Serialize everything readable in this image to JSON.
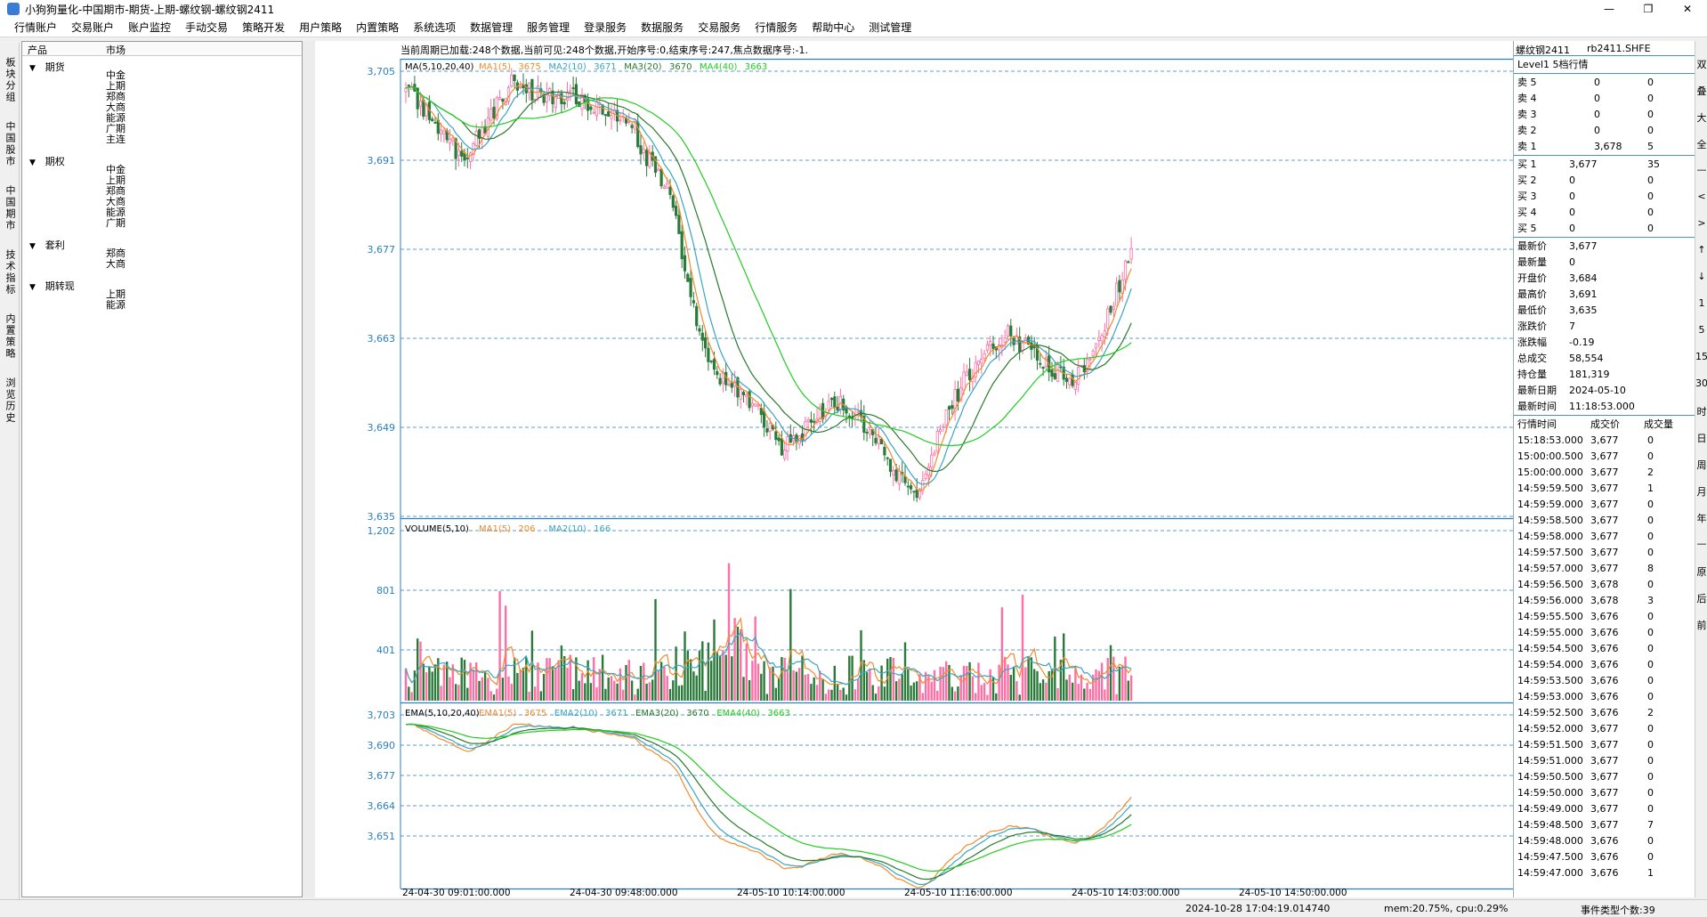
{
  "window": {
    "title": "小狗狗量化-中国期市-期货-上期-螺纹钢-螺纹钢2411",
    "controls": [
      "—",
      "❐",
      "✕"
    ]
  },
  "menu": [
    "行情账户",
    "交易账户",
    "账户监控",
    "手动交易",
    "策略开发",
    "用户策略",
    "内置策略",
    "系统选项",
    "数据管理",
    "服务管理",
    "登录服务",
    "数据服务",
    "交易服务",
    "行情服务",
    "帮助中心",
    "测试管理"
  ],
  "left_tabs": [
    "板块分组",
    "中国股市",
    "中国期市",
    "技术指标",
    "内置策略",
    "浏览历史"
  ],
  "tree": {
    "col_product": "产品",
    "col_market": "市场",
    "categories": [
      {
        "name": "期货",
        "markets": [
          "中金",
          "上期",
          "郑商",
          "大商",
          "能源",
          "广期",
          "主连"
        ]
      },
      {
        "name": "期权",
        "markets": [
          "中金",
          "上期",
          "郑商",
          "大商",
          "能源",
          "广期"
        ]
      },
      {
        "name": "套利",
        "markets": [
          "郑商",
          "大商"
        ]
      },
      {
        "name": "期转现",
        "markets": [
          "上期",
          "能源"
        ]
      }
    ]
  },
  "chart": {
    "info_line": "当前周期已加载:248个数据,当前可见:248个数据,开始序号:0,结束序号:247,焦点数据序号:-1.",
    "main": {
      "label": "MA(5,10,20,40)",
      "ma_legend": [
        {
          "name": "MA1(5)",
          "value": "3675",
          "color": "#f08c2e"
        },
        {
          "name": "MA2(10)",
          "value": "3671",
          "color": "#3aa5c2"
        },
        {
          "name": "MA3(20)",
          "value": "3670",
          "color": "#2a7a2a"
        },
        {
          "name": "MA4(40)",
          "value": "3663",
          "color": "#22cc22"
        }
      ],
      "y_labels": [
        "3,705",
        "3,691",
        "3,677",
        "3,663",
        "3,649",
        "3,635"
      ]
    },
    "volume": {
      "label": "VOLUME(5,10)",
      "ma_legend": [
        {
          "name": "MA1(5)",
          "value": "206",
          "color": "#f08c2e"
        },
        {
          "name": "MA2(10)",
          "value": "166",
          "color": "#3aa5c2"
        }
      ],
      "y_labels": [
        "1,202",
        "801",
        "401"
      ]
    },
    "ema": {
      "label": "EMA(5,10,20,40)",
      "ma_legend": [
        {
          "name": "EMA1(5)",
          "value": "3675",
          "color": "#f08c2e"
        },
        {
          "name": "EMA2(10)",
          "value": "3671",
          "color": "#3aa5c2"
        },
        {
          "name": "EMA3(20)",
          "value": "3670",
          "color": "#2a7a2a"
        },
        {
          "name": "EMA4(40)",
          "value": "3663",
          "color": "#22cc22"
        }
      ],
      "y_labels": [
        "3,703",
        "3,690",
        "3,677",
        "3,664",
        "3,651"
      ]
    },
    "x_labels": [
      "24-04-30 09:01:00.000",
      "24-04-30 09:48:00.000",
      "24-05-10 10:14:00.000",
      "24-05-10 11:16:00.000",
      "24-05-10 14:03:00.000",
      "24-05-10 14:50:00.000"
    ],
    "colors": {
      "up": "#ff6fa5",
      "down": "#2a7a3a",
      "axis": "#2a7fbf",
      "grid": "#2a7fbf"
    }
  },
  "chart_data": {
    "type": "candlestick",
    "count": 248,
    "main_ylim": [
      3635,
      3705
    ],
    "volume_ylim": [
      0,
      1202
    ],
    "ema_ylim": [
      3640,
      3706
    ],
    "last_close": 3677,
    "ma_last": {
      "ma5": 3675,
      "ma10": 3671,
      "ma20": 3670,
      "ma40": 3663
    },
    "vol_ma_last": {
      "ma5": 206,
      "ma10": 166
    },
    "close_path": [
      [
        0,
        3702
      ],
      [
        10,
        3697
      ],
      [
        20,
        3691
      ],
      [
        35,
        3703
      ],
      [
        42,
        3702
      ],
      [
        55,
        3701
      ],
      [
        70,
        3699
      ],
      [
        78,
        3696
      ],
      [
        80,
        3693
      ],
      [
        90,
        3686
      ],
      [
        94,
        3676
      ],
      [
        100,
        3664
      ],
      [
        105,
        3658
      ],
      [
        112,
        3655
      ],
      [
        120,
        3651
      ],
      [
        128,
        3646
      ],
      [
        135,
        3648
      ],
      [
        140,
        3651
      ],
      [
        148,
        3653
      ],
      [
        155,
        3650
      ],
      [
        162,
        3645
      ],
      [
        170,
        3640
      ],
      [
        175,
        3638
      ],
      [
        180,
        3646
      ],
      [
        185,
        3652
      ],
      [
        190,
        3656
      ],
      [
        197,
        3660
      ],
      [
        205,
        3664
      ],
      [
        212,
        3661
      ],
      [
        220,
        3658
      ],
      [
        228,
        3656
      ],
      [
        235,
        3661
      ],
      [
        242,
        3670
      ],
      [
        245,
        3675
      ],
      [
        247,
        3677
      ]
    ]
  },
  "quote": {
    "symbol_name": "螺纹钢2411",
    "symbol_code": "rb2411.SHFE",
    "level_title": "Level1 5档行情",
    "asks": [
      {
        "label": "卖 5",
        "price": "0",
        "vol": "0"
      },
      {
        "label": "卖 4",
        "price": "0",
        "vol": "0"
      },
      {
        "label": "卖 3",
        "price": "0",
        "vol": "0"
      },
      {
        "label": "卖 2",
        "price": "0",
        "vol": "0"
      },
      {
        "label": "卖 1",
        "price": "3,678",
        "vol": "5"
      }
    ],
    "bids": [
      {
        "label": "买 1",
        "price": "3,677",
        "vol": "35"
      },
      {
        "label": "买 2",
        "price": "0",
        "vol": "0"
      },
      {
        "label": "买 3",
        "price": "0",
        "vol": "0"
      },
      {
        "label": "买 4",
        "price": "0",
        "vol": "0"
      },
      {
        "label": "买 5",
        "price": "0",
        "vol": "0"
      }
    ],
    "stats": [
      {
        "label": "最新价",
        "value": "3,677"
      },
      {
        "label": "最新量",
        "value": "0"
      },
      {
        "label": "开盘价",
        "value": "3,684"
      },
      {
        "label": "最高价",
        "value": "3,691"
      },
      {
        "label": "最低价",
        "value": "3,635"
      },
      {
        "label": "涨跌价",
        "value": "7"
      },
      {
        "label": "涨跌幅",
        "value": "-0.19"
      },
      {
        "label": "总成交",
        "value": "58,554"
      },
      {
        "label": "持仓量",
        "value": "181,319"
      },
      {
        "label": "最新日期",
        "value": "2024-05-10"
      },
      {
        "label": "最新时间",
        "value": "11:18:53.000"
      }
    ],
    "ticks_header": {
      "time": "行情时间",
      "price": "成交价",
      "vol": "成交量"
    },
    "ticks": [
      [
        "15:18:53.000",
        "3,677",
        "0"
      ],
      [
        "15:00:00.500",
        "3,677",
        "0"
      ],
      [
        "15:00:00.000",
        "3,677",
        "2"
      ],
      [
        "14:59:59.500",
        "3,677",
        "1"
      ],
      [
        "14:59:59.000",
        "3,677",
        "0"
      ],
      [
        "14:59:58.500",
        "3,677",
        "0"
      ],
      [
        "14:59:58.000",
        "3,677",
        "0"
      ],
      [
        "14:59:57.500",
        "3,677",
        "0"
      ],
      [
        "14:59:57.000",
        "3,677",
        "8"
      ],
      [
        "14:59:56.500",
        "3,678",
        "0"
      ],
      [
        "14:59:56.000",
        "3,678",
        "3"
      ],
      [
        "14:59:55.500",
        "3,676",
        "0"
      ],
      [
        "14:59:55.000",
        "3,676",
        "0"
      ],
      [
        "14:59:54.500",
        "3,676",
        "0"
      ],
      [
        "14:59:54.000",
        "3,676",
        "0"
      ],
      [
        "14:59:53.500",
        "3,676",
        "0"
      ],
      [
        "14:59:53.000",
        "3,676",
        "0"
      ],
      [
        "14:59:52.500",
        "3,676",
        "2"
      ],
      [
        "14:59:52.000",
        "3,677",
        "0"
      ],
      [
        "14:59:51.500",
        "3,677",
        "0"
      ],
      [
        "14:59:51.000",
        "3,677",
        "0"
      ],
      [
        "14:59:50.500",
        "3,677",
        "0"
      ],
      [
        "14:59:50.000",
        "3,677",
        "0"
      ],
      [
        "14:59:49.000",
        "3,677",
        "0"
      ],
      [
        "14:59:48.500",
        "3,677",
        "7"
      ],
      [
        "14:59:48.000",
        "3,676",
        "0"
      ],
      [
        "14:59:47.500",
        "3,676",
        "0"
      ],
      [
        "14:59:47.000",
        "3,676",
        "1"
      ]
    ]
  },
  "right_tabs": [
    "双",
    "叠",
    "大",
    "全",
    "—",
    "<",
    ">",
    "↑",
    "↓",
    "1",
    "5",
    "15",
    "30",
    "时",
    "日",
    "周",
    "月",
    "年",
    "—",
    "原",
    "后",
    "前"
  ],
  "status": {
    "datetime": "2024-10-28 17:04:19.014740",
    "resources": "mem:20.75%, cpu:0.29%",
    "event_count": "事件类型个数:39"
  }
}
